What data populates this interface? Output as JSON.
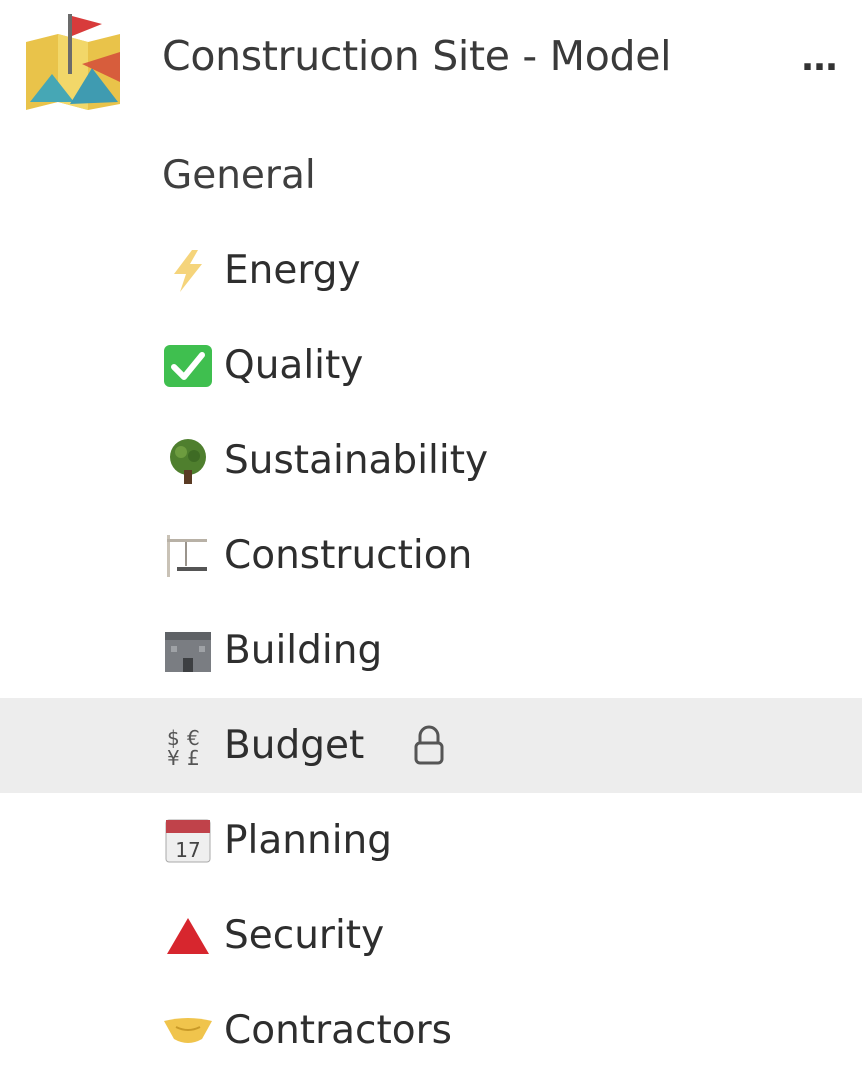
{
  "team": {
    "name": "Construction Site - Model",
    "more_label": "…"
  },
  "channels": [
    {
      "label": "General",
      "icon": "none"
    },
    {
      "label": "Energy",
      "icon": "lightning-icon"
    },
    {
      "label": "Quality",
      "icon": "check-box-icon"
    },
    {
      "label": "Sustainability",
      "icon": "tree-icon"
    },
    {
      "label": "Construction",
      "icon": "construction-icon"
    },
    {
      "label": "Building",
      "icon": "building-icon"
    },
    {
      "label": "Budget",
      "icon": "money-icon",
      "selected": true,
      "locked": true
    },
    {
      "label": "Planning",
      "icon": "calendar-icon",
      "calendar_day": "17"
    },
    {
      "label": "Security",
      "icon": "warning-triangle-icon"
    },
    {
      "label": "Contractors",
      "icon": "handshake-icon"
    }
  ],
  "colors": {
    "selected_bg": "#ededed",
    "check_green": "#3fbf4f",
    "warning_red": "#d7262e",
    "flag_red": "#d83b3b"
  }
}
